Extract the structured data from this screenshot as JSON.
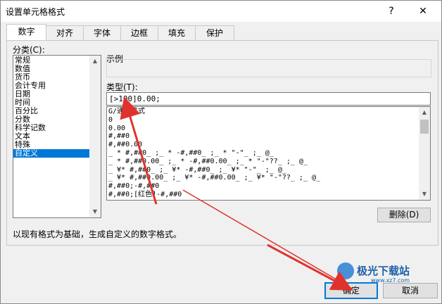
{
  "dialog": {
    "title": "设置单元格格式",
    "help": "?",
    "close": "✕"
  },
  "tabs": [
    "数字",
    "对齐",
    "字体",
    "边框",
    "填充",
    "保护"
  ],
  "category": {
    "label": "分类(C):",
    "items": [
      "常规",
      "数值",
      "货币",
      "会计专用",
      "日期",
      "时间",
      "百分比",
      "分数",
      "科学记数",
      "文本",
      "特殊",
      "自定义"
    ],
    "selected_index": 11
  },
  "sample": {
    "label": "示例"
  },
  "type": {
    "label": "类型(T):",
    "value": "[>100]0.00;",
    "formats": [
      "G/通用格式",
      "0",
      "0.00",
      "#,##0",
      "#,##0.00",
      "_ * #,##0_ ;_ * -#,##0_ ;_ * \"-\"_ ;_ @_",
      "_ * #,##0.00_ ;_ * -#,##0.00_ ;_ * \"-\"??_ ;_ @_",
      "_ ¥* #,##0_ ;_ ¥* -#,##0_ ;_ ¥* \"-\"_ ;_ @_",
      "_ ¥* #,##0.00_ ;_ ¥* -#,##0.00_ ;_ ¥* \"-\"??_ ;_ @_",
      "#,##0;-#,##0",
      "#,##0;[红色]-#,##0"
    ]
  },
  "delete_button": "删除(D)",
  "description": "以现有格式为基础，生成自定义的数字格式。",
  "ok_button": "确定",
  "cancel_button": "取消",
  "watermark": {
    "text": "极光下载站",
    "url": "www.xz7.com"
  },
  "colors": {
    "accent": "#0078d7",
    "arrow": "#e0322d"
  }
}
